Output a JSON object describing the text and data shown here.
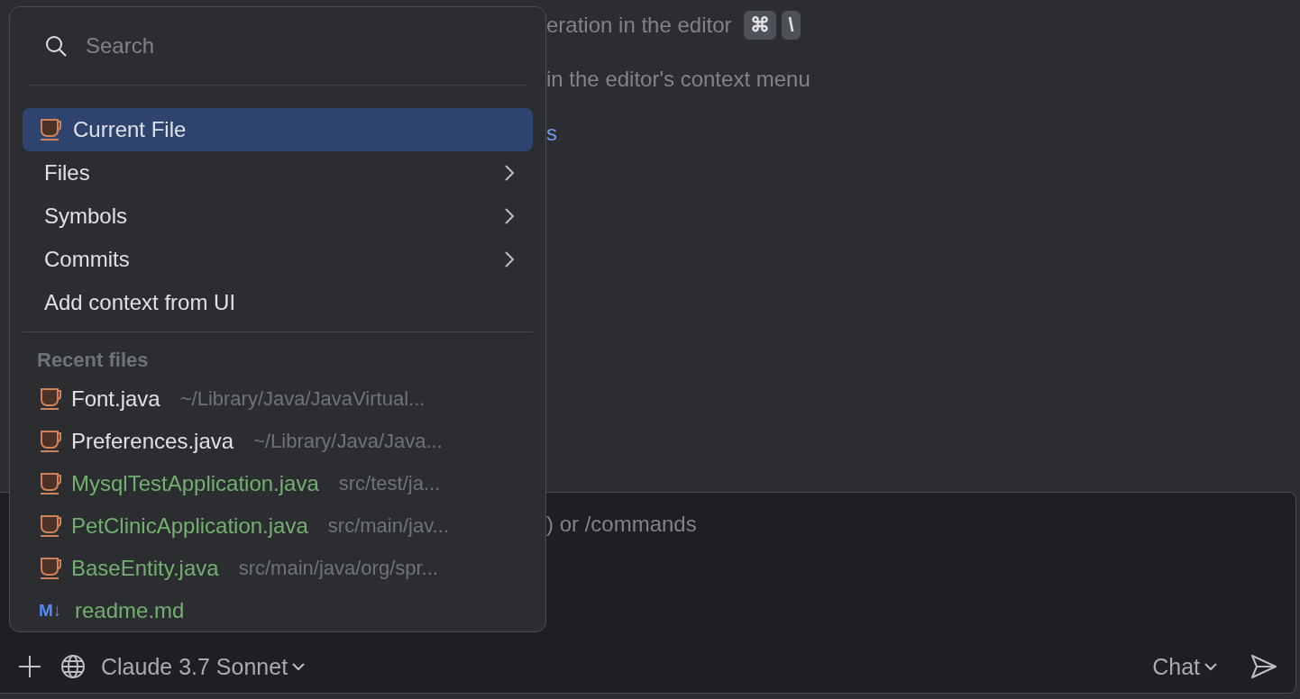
{
  "editor_hints": [
    {
      "kind": "text",
      "text": "eration in the editor",
      "keys": [
        "⌘",
        "\\"
      ]
    },
    {
      "kind": "text",
      "text": "in the editor's context menu"
    },
    {
      "kind": "link",
      "text": "s"
    }
  ],
  "chat_input": {
    "placeholder": ") or /commands",
    "model": "Claude 3.7 Sonnet",
    "mode": "Chat"
  },
  "context_popup": {
    "search": {
      "placeholder": "Search"
    },
    "items": [
      {
        "label": "Current File",
        "kind": "file",
        "selected": true
      },
      {
        "label": "Files",
        "kind": "submenu",
        "selected": false
      },
      {
        "label": "Symbols",
        "kind": "submenu",
        "selected": false
      },
      {
        "label": "Commits",
        "kind": "submenu",
        "selected": false
      },
      {
        "label": "Add context from UI",
        "kind": "action",
        "selected": false
      }
    ],
    "recent_files": {
      "title": "Recent files",
      "files": [
        {
          "name": "Font.java",
          "path": "~/Library/Java/JavaVirtual...",
          "kind": "java",
          "added": false
        },
        {
          "name": "Preferences.java",
          "path": "~/Library/Java/Java...",
          "kind": "java",
          "added": false
        },
        {
          "name": "MysqlTestApplication.java",
          "path": "src/test/ja...",
          "kind": "java",
          "added": true
        },
        {
          "name": "PetClinicApplication.java",
          "path": "src/main/jav...",
          "kind": "java",
          "added": true
        },
        {
          "name": "BaseEntity.java",
          "path": "src/main/java/org/spr...",
          "kind": "java",
          "added": true
        },
        {
          "name": "readme.md",
          "kind": "markdown",
          "icon": "M↓",
          "added": true
        }
      ]
    }
  }
}
